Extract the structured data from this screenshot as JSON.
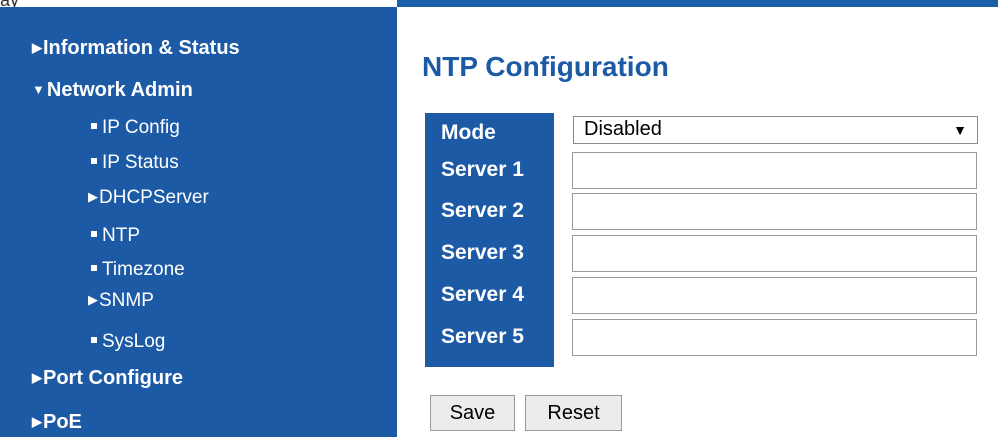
{
  "topbar": {
    "partial_text": "ay"
  },
  "sidebar": {
    "items": [
      {
        "label": "Information & Status",
        "marker": "collapsed"
      },
      {
        "label": "Network Admin",
        "marker": "expanded"
      },
      {
        "label": "IP Config",
        "marker": "bullet"
      },
      {
        "label": "IP Status",
        "marker": "bullet"
      },
      {
        "label": "DHCPServer",
        "marker": "collapsed"
      },
      {
        "label": "NTP",
        "marker": "bullet"
      },
      {
        "label": "Timezone",
        "marker": "bullet"
      },
      {
        "label": "SNMP",
        "marker": "collapsed"
      },
      {
        "label": "SysLog",
        "marker": "bullet"
      },
      {
        "label": "Port Configure",
        "marker": "collapsed"
      },
      {
        "label": "PoE",
        "marker": "collapsed"
      }
    ]
  },
  "main": {
    "title": "NTP Configuration",
    "mode": {
      "label": "Mode",
      "value": "Disabled"
    },
    "servers": [
      {
        "label": "Server 1",
        "value": ""
      },
      {
        "label": "Server 2",
        "value": ""
      },
      {
        "label": "Server 3",
        "value": ""
      },
      {
        "label": "Server 4",
        "value": ""
      },
      {
        "label": "Server 5",
        "value": ""
      }
    ],
    "buttons": {
      "save": "Save",
      "reset": "Reset"
    }
  },
  "colors": {
    "sidebar_bg": "#1c5aa6",
    "title": "#1c5aa6",
    "label_bg": "#1c5aa6"
  },
  "icons": {
    "collapsed": "triangle-right-icon",
    "expanded": "triangle-down-icon",
    "bullet": "square-bullet-icon",
    "dropdown": "dropdown-arrow-icon"
  }
}
